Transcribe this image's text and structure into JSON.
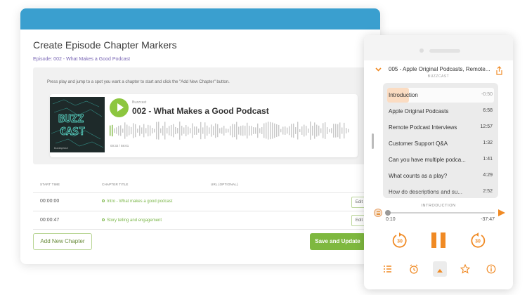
{
  "editor": {
    "title": "Create Episode Chapter Markers",
    "episode_link": "Episode: 002 - What Makes a Good Podcast",
    "instructions": "Press play and jump to a spot you want a chapter to start and click the \"Add New Chapter\" button.",
    "player": {
      "show_name": "Buzzcast",
      "episode_title": "002 - What Makes a Good Podcast",
      "time_readout": "00:32  /  58:01",
      "cover_text": "BUZZ CAST",
      "cover_brand": "buzzsprout"
    },
    "columns": {
      "start_time": "START TIME",
      "chapter_title": "CHAPTER TITLE",
      "url": "URL (OPTIONAL)"
    },
    "rows": [
      {
        "start_time": "00:00:00",
        "chapter": "Intro - What makes a good podcast",
        "edit_label": "Edit"
      },
      {
        "start_time": "00:00:47",
        "chapter": "Story telling and engagement",
        "edit_label": "Edit"
      }
    ],
    "add_button": "Add New Chapter",
    "save_button": "Save and Update",
    "colors": {
      "header_bar": "#3a9fcf",
      "accent_green": "#7eb83f",
      "link_purple": "#7a67b5"
    }
  },
  "phone": {
    "now_playing_title": "005 - Apple Original Podcasts, Remote...",
    "now_playing_subtitle": "BUZZCAST",
    "chapters": [
      {
        "label": "Introduction",
        "time": "-0:50",
        "active": true
      },
      {
        "label": "Apple Original Podcasts",
        "time": "6:58"
      },
      {
        "label": "Remote Podcast Interviews",
        "time": "12:57"
      },
      {
        "label": "Customer Support Q&A",
        "time": "1:32"
      },
      {
        "label": "Can you have multiple podca...",
        "time": "1:41"
      },
      {
        "label": "What counts as a play?",
        "time": "4:29"
      },
      {
        "label": "How do descriptions and su...",
        "time": "2:52"
      }
    ],
    "current_chapter": "INTRODUCTION",
    "elapsed": "0:10",
    "remaining": "-37:47",
    "progress_fraction": 0.02,
    "skip_back_label": "30",
    "skip_forward_label": "30",
    "accent": "#f08a24",
    "icons": [
      "chevron-down-icon",
      "share-icon",
      "chapter-list-icon",
      "next-chapter-icon",
      "skip-back-icon",
      "pause-icon",
      "skip-forward-icon",
      "list-icon",
      "sleep-timer-icon",
      "airplay-icon",
      "star-icon",
      "info-icon"
    ]
  }
}
